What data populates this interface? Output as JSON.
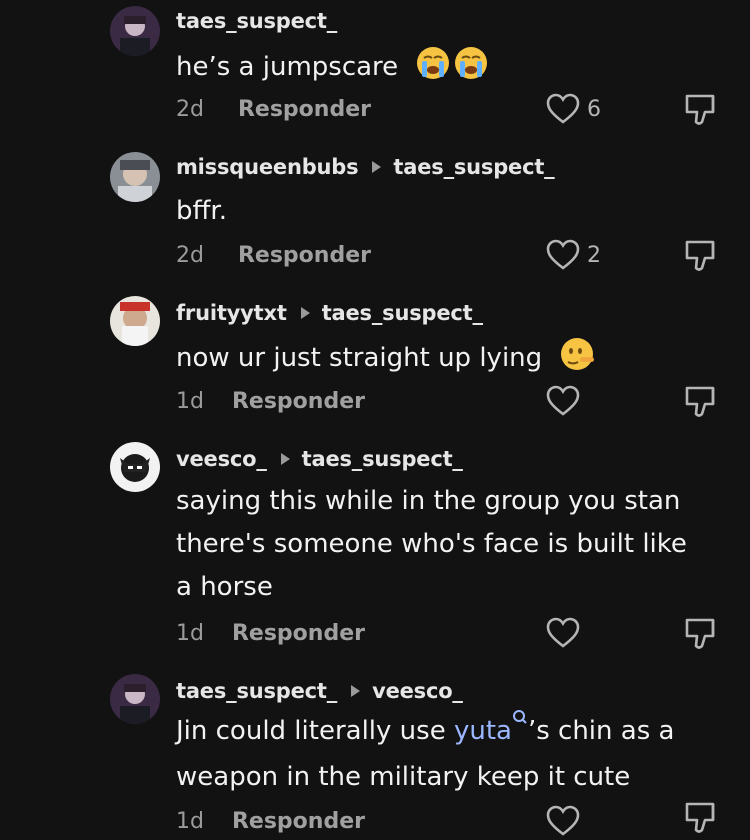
{
  "comments": [
    {
      "username": "taes_suspect_",
      "reply_to": "",
      "text": "he’s a jumpscare",
      "time": "2d",
      "reply_label": "Responder",
      "likes": "6"
    },
    {
      "username": "missqueenbubs",
      "reply_to": "taes_suspect_",
      "text": "bffr.",
      "time": "2d",
      "reply_label": "Responder",
      "likes": "2"
    },
    {
      "username": "fruityytxt",
      "reply_to": "taes_suspect_",
      "text": "now ur just straight up lying",
      "time": "1d",
      "reply_label": "Responder",
      "likes": ""
    },
    {
      "username": "veesco_",
      "reply_to": "taes_suspect_",
      "text_lines": [
        "saying this while in the group you stan",
        "there's someone who's face is built like",
        "a horse"
      ],
      "time": "1d",
      "reply_label": "Responder",
      "likes": ""
    },
    {
      "username": "taes_suspect_",
      "reply_to": "veesco_",
      "text_before": "Jin could literally use",
      "mention": "yuta",
      "text_after": "’s chin as a",
      "text_line2": "weapon in the military keep it cute",
      "time": "1d",
      "reply_label": "Responder",
      "likes": ""
    }
  ],
  "colors": {
    "background": "#121212",
    "mention": "#9bb7ff",
    "meta": "#9b9b9b"
  },
  "icons": [
    "loudly-crying-face-emoji",
    "lying-face-emoji",
    "heart-icon",
    "dislike-icon",
    "search-mention-icon",
    "play-arrow-icon"
  ]
}
